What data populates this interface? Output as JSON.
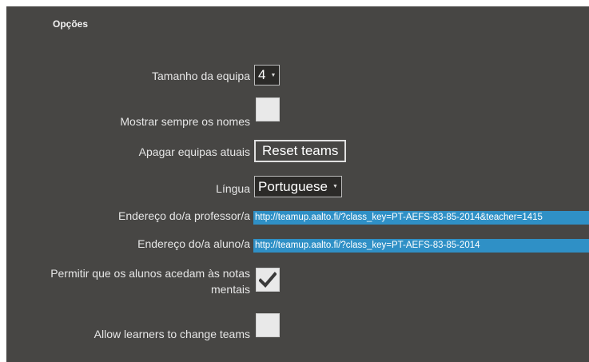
{
  "section": {
    "title": "Opções"
  },
  "team_size": {
    "label": "Tamanho da equipa",
    "value": "4"
  },
  "show_names": {
    "label": "Mostrar sempre os nomes",
    "checked": false
  },
  "delete_teams": {
    "label": "Apagar equipas atuais",
    "button_label": "Reset teams"
  },
  "language": {
    "label": "Língua",
    "value": "Portuguese"
  },
  "teacher_address": {
    "label": "Endereço do/a professor/a",
    "value": "http://teamup.aalto.fi/?class_key=PT-AEFS-83-85-2014&teacher=1415"
  },
  "student_address": {
    "label": "Endereço do/a aluno/a",
    "value": "http://teamup.aalto.fi/?class_key=PT-AEFS-83-85-2014"
  },
  "notes_access": {
    "label": "Permitir que os alunos acedam às notas mentais",
    "checked": true
  },
  "change_teams": {
    "label": "Allow learners to change teams",
    "checked": false
  },
  "colors": {
    "panel": "#474644",
    "highlight": "#2f90c6",
    "text": "#e6e6e6"
  },
  "icons": {
    "dropdown": "caret-down-icon",
    "check": "checkmark-icon"
  }
}
